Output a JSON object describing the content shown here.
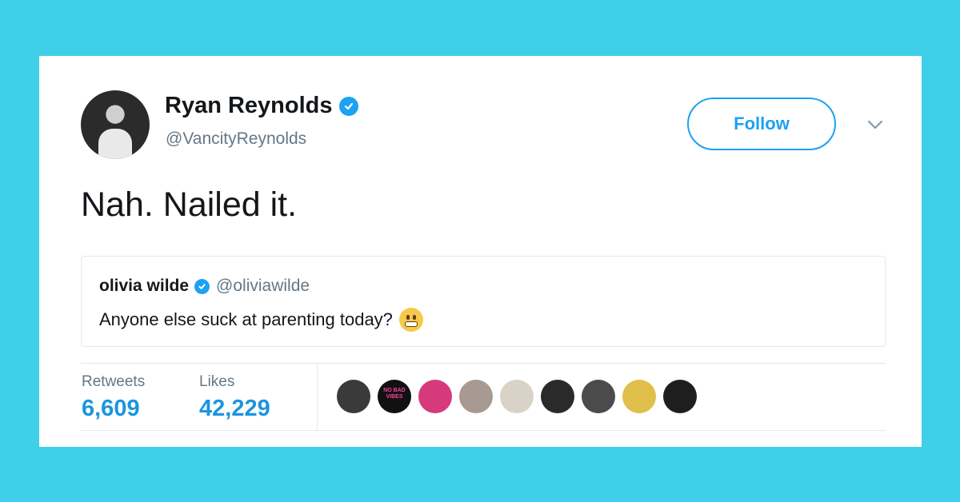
{
  "tweet": {
    "author_name": "Ryan Reynolds",
    "author_handle": "@VancityReynolds",
    "follow_label": "Follow",
    "text": "Nah. Nailed it.",
    "quoted": {
      "author_name": "olivia wilde",
      "author_handle": "@oliviawilde",
      "text": "Anyone else suck at parenting today?",
      "emoji": "grimacing-face"
    },
    "stats": {
      "retweets_label": "Retweets",
      "retweets_value": "6,609",
      "likes_label": "Likes",
      "likes_value": "42,229"
    },
    "liker_avatars": [
      {
        "name": "liker-avatar-1",
        "color": "#3a3a3a"
      },
      {
        "name": "liker-avatar-2",
        "color": "#111111",
        "text": "NO BAD VIBES"
      },
      {
        "name": "liker-avatar-3",
        "color": "#d63a7c"
      },
      {
        "name": "liker-avatar-4",
        "color": "#a89a90"
      },
      {
        "name": "liker-avatar-5",
        "color": "#d8d3c6"
      },
      {
        "name": "liker-avatar-6",
        "color": "#2a2a2a"
      },
      {
        "name": "liker-avatar-7",
        "color": "#4b4b4b"
      },
      {
        "name": "liker-avatar-8",
        "color": "#e0c04a"
      },
      {
        "name": "liker-avatar-9",
        "color": "#1e1e1e"
      }
    ]
  },
  "colors": {
    "background": "#3fcfe8",
    "accent": "#1da1f2",
    "stat_value": "#1b95e0",
    "text_primary": "#14171a",
    "text_secondary": "#657786"
  }
}
